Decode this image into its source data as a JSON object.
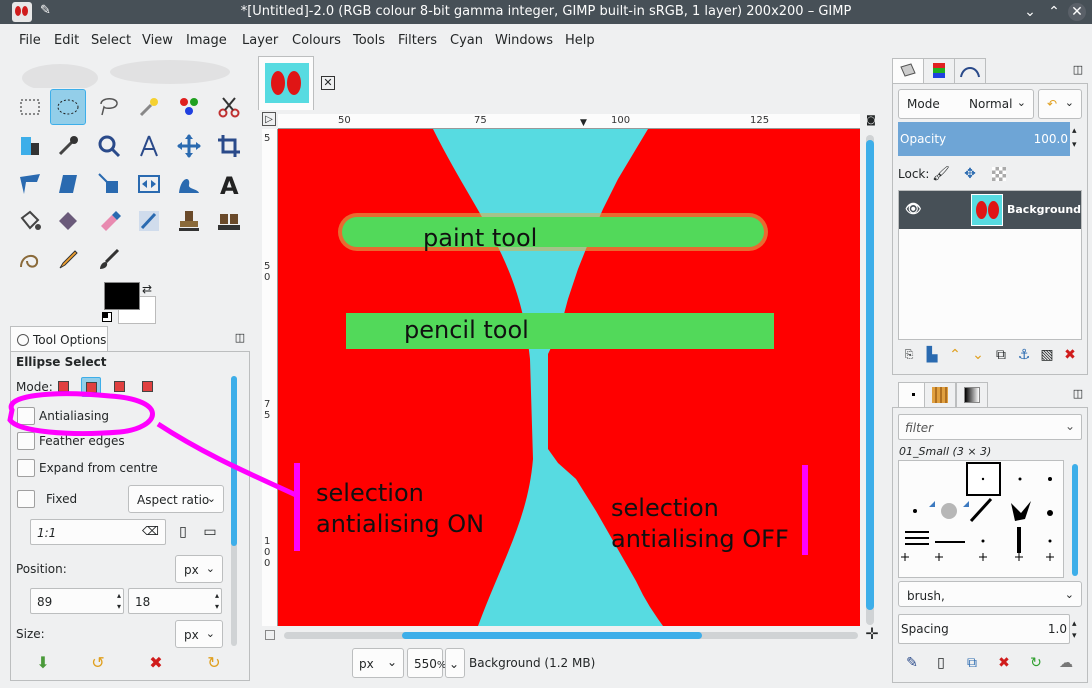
{
  "window": {
    "title": "*[Untitled]-2.0 (RGB colour 8-bit gamma integer, GIMP built-in sRGB, 1 layer) 200x200 – GIMP"
  },
  "menu": [
    "File",
    "Edit",
    "Select",
    "View",
    "Image",
    "Layer",
    "Colours",
    "Tools",
    "Filters",
    "Cyan",
    "Windows",
    "Help"
  ],
  "tool_options": {
    "tab_label": "Tool Options",
    "tool_name": "Ellipse Select",
    "mode_label": "Mode:",
    "antialiasing": "Antialiasing",
    "feather_edges": "Feather edges",
    "expand_from_centre": "Expand from centre",
    "fixed": "Fixed",
    "aspect_ratio": "Aspect ratio",
    "ratio_value": "1:1",
    "position_label": "Position:",
    "position_unit": "px",
    "position_x": "89",
    "position_y": "18",
    "size_label": "Size:",
    "size_unit": "px"
  },
  "canvas": {
    "ruler_h": [
      "50",
      "75",
      "100",
      "125"
    ],
    "ruler_v": [
      [
        "5"
      ],
      [
        "5",
        "0"
      ],
      [
        "7",
        "5"
      ],
      [
        "1",
        "0",
        "0"
      ]
    ],
    "annotations": {
      "paint_tool": "paint tool",
      "pencil_tool": "pencil tool",
      "sel_on_line1": "selection",
      "sel_on_line2": "antialising ON",
      "sel_off_line1": "selection",
      "sel_off_line2": "antialising OFF"
    },
    "colors": {
      "red": "#ff0000",
      "cyan": "#57dbe1",
      "green": "#52d95a",
      "magenta": "#ff00ff"
    }
  },
  "status": {
    "unit": "px",
    "zoom": "550",
    "zoom_suffix": "%",
    "info": "Background (1.2 MB)"
  },
  "layers": {
    "mode_label": "Mode",
    "mode_value": "Normal",
    "opacity_label": "Opacity",
    "opacity_value": "100.0",
    "lock_label": "Lock:",
    "layer_name": "Background"
  },
  "brushes": {
    "filter_placeholder": "filter",
    "brush_set": "01_Small (3 × 3)",
    "tag_value": "brush,",
    "spacing_label": "Spacing",
    "spacing_value": "1.0"
  }
}
